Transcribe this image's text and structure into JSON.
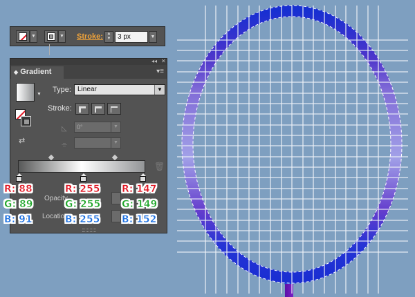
{
  "control_bar": {
    "stroke_label": "Stroke:",
    "stroke_weight": "3 px"
  },
  "panel": {
    "title": "Gradient",
    "type_label": "Type:",
    "type_value": "Linear",
    "stroke_label": "Stroke:",
    "angle_value": "0°",
    "opacity_label": "Opacity",
    "location_label": "Location"
  },
  "gradient": {
    "stop_1": {
      "r_label": "R: 88",
      "g_label": "G: 89",
      "b_label": "B: 91",
      "color": "#58595b"
    },
    "stop_2": {
      "r_label": "R: 255",
      "g_label": "G: 255",
      "b_label": "B: 255",
      "color": "#ffffff"
    },
    "stop_3": {
      "r_label": "R: 147",
      "g_label": "G: 149",
      "b_label": "B: 152",
      "color": "#939598"
    }
  },
  "colors": {
    "canvas": "#7e9fc0",
    "panel_bg": "#535353",
    "frame_blue": "#1c3fd6",
    "frame_purple": "#8a3fc7",
    "stroke_link": "#f0a33a",
    "red_label": "#e01421",
    "green_label": "#1fa62a",
    "blue_label": "#1b6fe0"
  },
  "icons": {
    "fill_none": "none-swatch-icon",
    "stroke_swatch": "stroke-swatch-icon",
    "reverse": "reverse-gradient-icon",
    "angle": "angle-icon",
    "aspect": "aspect-ratio-icon",
    "delete_stop": "trash-icon",
    "panel_menu": "panel-menu-icon",
    "collapse": "collapse-icon",
    "close": "close-icon"
  }
}
